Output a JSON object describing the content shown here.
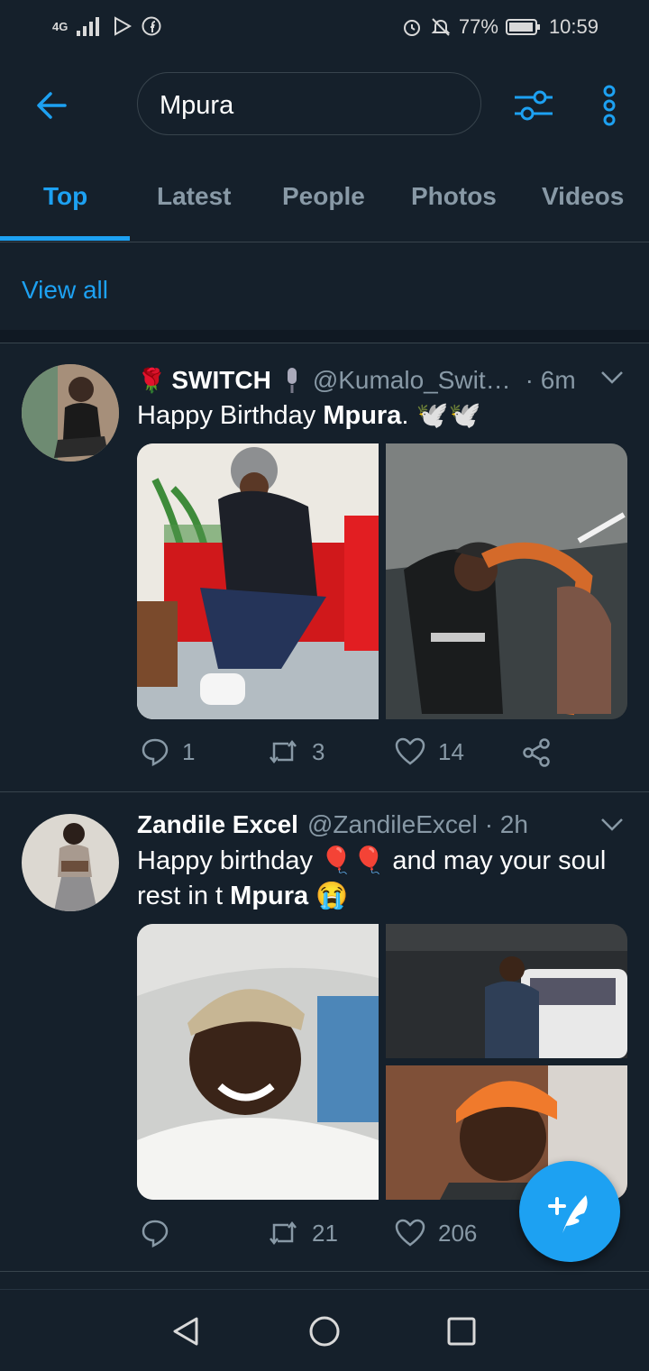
{
  "status_bar": {
    "network": "4G",
    "battery": "77%",
    "time": "10:59"
  },
  "search": {
    "query": "Mpura"
  },
  "tabs": [
    {
      "label": "Top",
      "active": true
    },
    {
      "label": "Latest",
      "active": false
    },
    {
      "label": "People",
      "active": false
    },
    {
      "label": "Photos",
      "active": false
    },
    {
      "label": "Videos",
      "active": false
    }
  ],
  "view_all": "View all",
  "tweets": [
    {
      "name": "SWITCH",
      "handle": "@Kumalo_Swit…",
      "time": "· 6m",
      "text_before": "Happy Birthday ",
      "text_bold": "Mpura",
      "text_after": ". 🕊️🕊️",
      "replies": "1",
      "retweets": "3",
      "likes": "14"
    },
    {
      "name": "Zandile Excel",
      "handle": "@ZandileExcel",
      "time": "· 2h",
      "text_before": "Happy birthday 🎈🎈 and may your soul rest in t ",
      "text_bold": "Mpura",
      "text_after": " 😭",
      "replies": "",
      "retweets": "21",
      "likes": "206"
    }
  ],
  "colors": {
    "background": "#15202b",
    "accent": "#1da1f2",
    "muted": "#8899a6",
    "divider": "#38444d"
  },
  "icons": [
    "back-arrow-icon",
    "filter-icon",
    "more-vertical-icon",
    "reply-icon",
    "retweet-icon",
    "like-icon",
    "share-icon",
    "compose-icon",
    "nav-back-icon",
    "nav-home-icon",
    "nav-recents-icon"
  ]
}
